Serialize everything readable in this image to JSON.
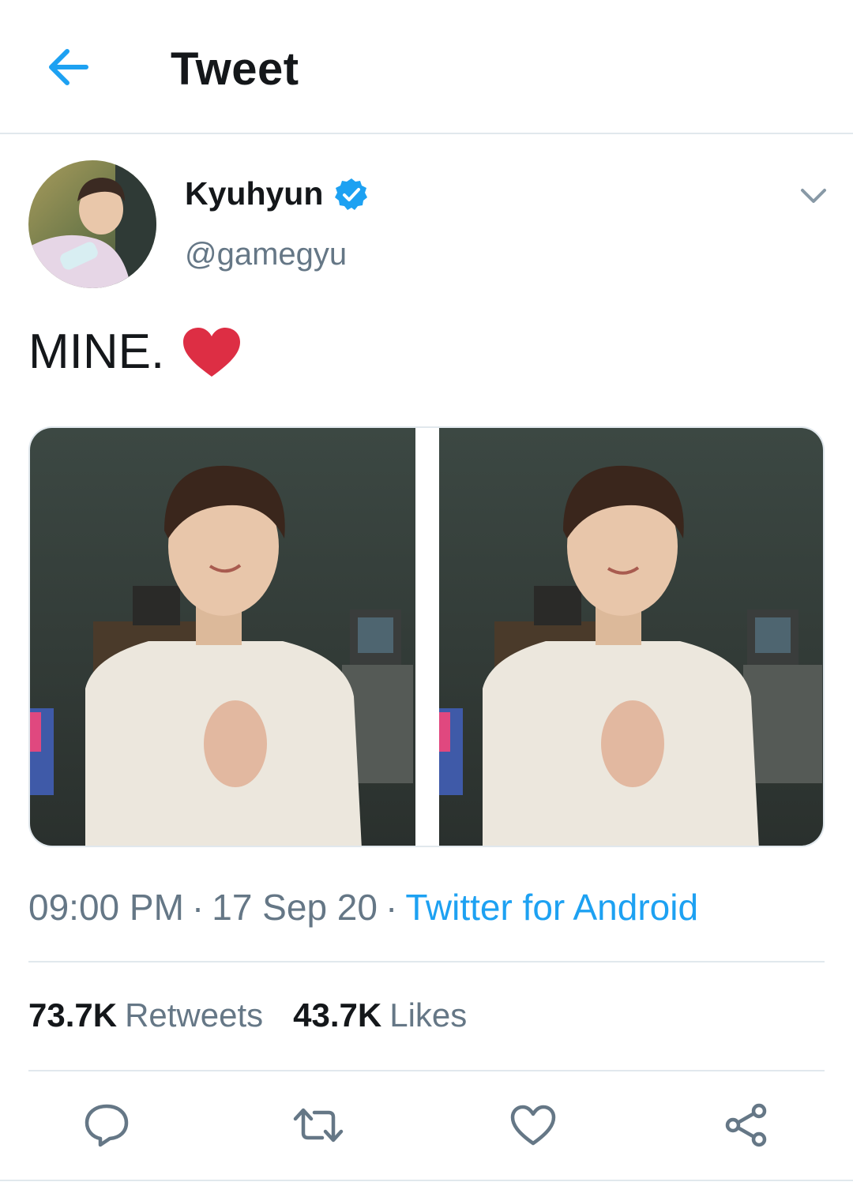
{
  "header": {
    "title": "Tweet"
  },
  "author": {
    "name": "Kyuhyun",
    "handle": "@gamegyu"
  },
  "tweet": {
    "text": "MINE.",
    "emoji": "heart"
  },
  "meta": {
    "time": "09:00 PM",
    "date": "17 Sep 20",
    "source": "Twitter for Android",
    "separator": "·"
  },
  "stats": {
    "retweets": {
      "count": "73.7K",
      "label": "Retweets"
    },
    "likes": {
      "count": "43.7K",
      "label": "Likes"
    }
  },
  "icons": {
    "back": "back-arrow-icon",
    "verified": "verified-badge-icon",
    "caret": "chevron-down-icon",
    "reply": "reply-icon",
    "retweet": "retweet-icon",
    "like": "heart-icon",
    "share": "share-icon"
  },
  "colors": {
    "accent": "#1da1f2",
    "secondary_text": "#657786",
    "primary_text": "#14171a",
    "divider": "#e1e8ed",
    "heart_emoji": "#dd2e44"
  }
}
